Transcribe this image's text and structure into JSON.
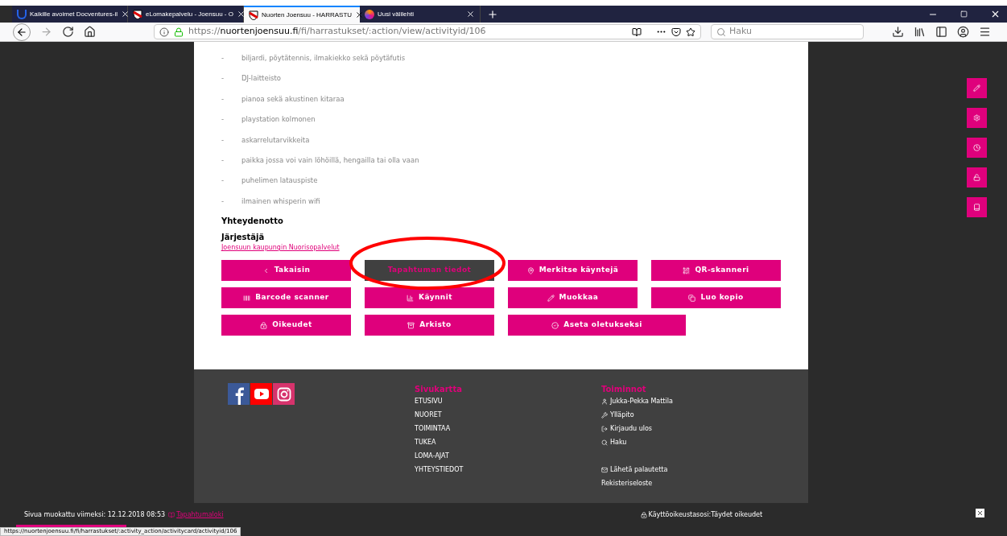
{
  "browser": {
    "tabs": [
      {
        "title": "Kaikille avoimet Docventures-il",
        "selected": false,
        "kind": "docventures"
      },
      {
        "title": "eLomakepalvelu - Joensuu - O",
        "selected": false,
        "kind": "shield"
      },
      {
        "title": "Nuorten Joensuu - HARRASTU",
        "selected": true,
        "kind": "shield"
      },
      {
        "title": "Uusi välilehti",
        "selected": false,
        "kind": "firefox"
      }
    ],
    "url": {
      "prefix": "https://",
      "domain": "nuortenjoensuu.fi",
      "path": "/fi/harrastukset/:action/view/activityid/106"
    },
    "search": {
      "placeholder": "Haku"
    }
  },
  "amenities": [
    {
      "bullet": "-",
      "text": "biljardi, pöytätennis, ilmakiekko sekä pöytäfutis"
    },
    {
      "bullet": "-",
      "text": "DJ-laitteisto"
    },
    {
      "bullet": "-",
      "text": "pianoa sekä akustinen kitaraa"
    },
    {
      "bullet": "-",
      "text": "playstation kolmonen"
    },
    {
      "bullet": "-",
      "text": "askarrelutarvikkeita"
    },
    {
      "bullet": "-",
      "text": "paikka jossa voi vain löhöillä, hengailla tai olla vaan"
    },
    {
      "bullet": "-",
      "text": "puhelimen latauspiste"
    },
    {
      "bullet": "-",
      "text": "ilmainen whisperin wifi"
    }
  ],
  "contact": {
    "heading": "Yhteydenotto",
    "organizer_label": "Järjestäjä",
    "organizer": "Joensuun kaupungin Nuorisopalvelut"
  },
  "actions": [
    {
      "label": "Takaisin",
      "selected": false
    },
    {
      "label": "Tapahtuman tiedot",
      "selected": true
    },
    {
      "label": "Merkitse käyntejä",
      "selected": false
    },
    {
      "label": "QR-skanneri",
      "selected": false
    },
    {
      "label": "Barcode scanner",
      "selected": false
    },
    {
      "label": "Käynnit",
      "selected": false
    },
    {
      "label": "Muokkaa",
      "selected": false
    },
    {
      "label": "Luo kopio",
      "selected": false
    },
    {
      "label": "Oikeudet",
      "selected": false
    },
    {
      "label": "Arkisto",
      "selected": false
    },
    {
      "label": "Aseta oletukseksi",
      "selected": false
    }
  ],
  "footer": {
    "sitemap_heading": "Sivukartta",
    "sitemap": [
      "ETUSIVU",
      "NUORET",
      "TOIMINTAA",
      "TUKEA",
      "LOMA-AJAT",
      "YHTEYSTIEDOT"
    ],
    "actions_heading": "Toiminnot",
    "actions": [
      "Jukka-Pekka Mattila",
      "Ylläpito",
      "Kirjaudu ulos",
      "Haku",
      "Lähetä palautetta",
      "Rekisteriseloste"
    ]
  },
  "bottom_bar": {
    "modified": "Sivua muokattu viimeksi: 12.12.2018 08:53",
    "log_link": "Tapahtumaloki",
    "access": "Käyttöoikeustasosi:Täydet oikeudet"
  },
  "status_url": "https://nuortenjoensuu.fi/fi/harrastukset/:activity_action/activitycard/activityid/106"
}
